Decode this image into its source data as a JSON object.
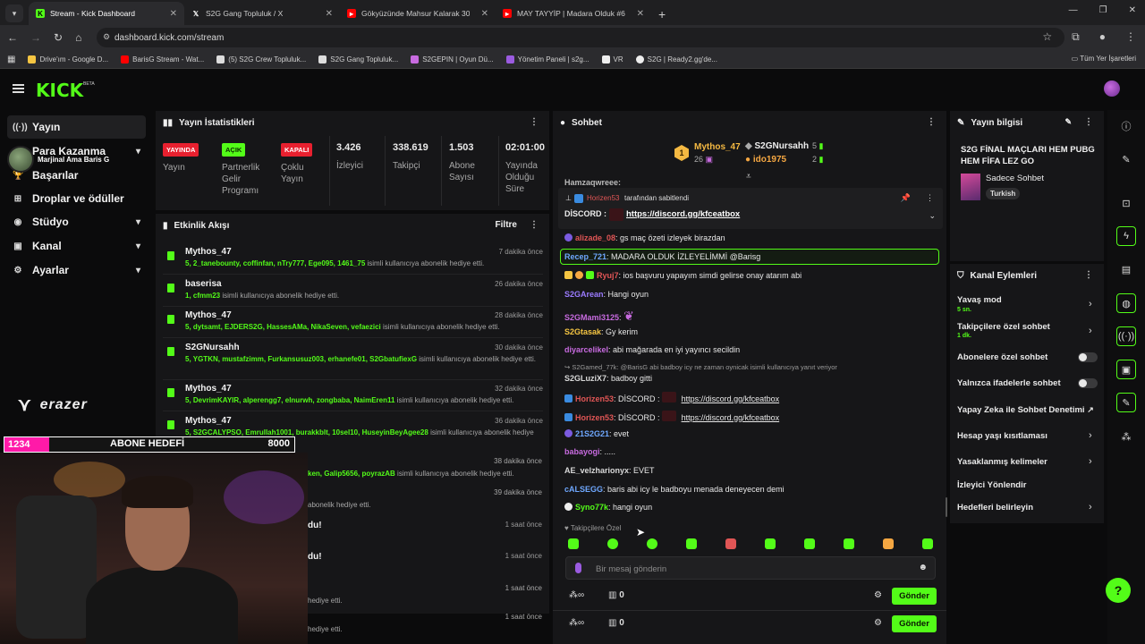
{
  "browser": {
    "tabs": [
      {
        "title": "Stream - Kick Dashboard",
        "active": true,
        "icon": "kick-icon"
      },
      {
        "title": "S2G Gang Topluluk / X",
        "active": false,
        "icon": "x-icon"
      },
      {
        "title": "Gökyüzünde Mahsur Kalarak 30",
        "active": false,
        "icon": "youtube-icon"
      },
      {
        "title": "MAY TAYYİP | Madara Olduk #6",
        "active": false,
        "icon": "youtube-icon"
      }
    ],
    "url": "dashboard.kick.com/stream",
    "bookmarks": [
      {
        "label": "Drive'ım - Google D..."
      },
      {
        "label": "BarisG Stream - Wat..."
      },
      {
        "label": "(5) S2G Crew Topluluk..."
      },
      {
        "label": "S2G Gang Topluluk..."
      },
      {
        "label": "S2GEPIN | Oyun Dü..."
      },
      {
        "label": "Yönetim Paneli | s2g..."
      },
      {
        "label": "VR"
      },
      {
        "label": "S2G | Ready2.gg'de..."
      }
    ],
    "bookmarks_right": "Tüm Yer İşaretleri"
  },
  "kick": {
    "logo": "KICK",
    "beta": "BETA"
  },
  "sidebar": {
    "items": [
      {
        "label": "Yayın",
        "icon": "broadcast-icon",
        "chev": ""
      },
      {
        "label": "Para Kazanma",
        "icon": "dollar-icon",
        "chev": "▾"
      },
      {
        "label": "Başarılar",
        "icon": "trophy-icon",
        "chev": ""
      },
      {
        "label": "Droplar ve ödüller",
        "icon": "gift-icon",
        "chev": ""
      },
      {
        "label": "Stüdyo",
        "icon": "studio-icon",
        "chev": "▾"
      },
      {
        "label": "Kanal",
        "icon": "channel-icon",
        "chev": "▾"
      },
      {
        "label": "Ayarlar",
        "icon": "gear-icon",
        "chev": "▾"
      }
    ],
    "streamer_overlay": "Marjinal Ama Baris G"
  },
  "stats": {
    "title": "Yayın İstatistikleri",
    "items": [
      {
        "badge": "YAYINDA",
        "badge_color": "red",
        "label": "Yayın"
      },
      {
        "badge": "AÇIK",
        "badge_color": "green",
        "label": "Partnerlik Gelir Programı"
      },
      {
        "badge": "KAPALI",
        "badge_color": "red",
        "label": "Çoklu Yayın"
      },
      {
        "value": "3.426",
        "label": "İzleyici"
      },
      {
        "value": "338.619",
        "label": "Takipçi"
      },
      {
        "value": "1.503",
        "label": "Abone Sayısı"
      },
      {
        "value": "02:01:00",
        "label": "Yayında Olduğu Süre"
      }
    ]
  },
  "activity": {
    "title": "Etkinlik Akışı",
    "filter": "Filtre",
    "items": [
      {
        "name": "Mythos_47",
        "time": "7 dakika önce",
        "gifts": "5, 2_tanebounty, coffinfan, nTry777, Ege095, 1461_75",
        "suffix": " isimli kullanıcıya abonelik hediye etti."
      },
      {
        "name": "baserisa",
        "time": "26 dakika önce",
        "gifts": "1, cfmm23",
        "suffix": " isimli kullanıcıya abonelik hediye etti."
      },
      {
        "name": "Mythos_47",
        "time": "28 dakika önce",
        "gifts": "5, dytsamt, EJDERS2G, HassesAMa, NikaSeven, vefaezici",
        "suffix": " isimli kullanıcıya abonelik hediye etti."
      },
      {
        "name": "S2GNursahh",
        "time": "30 dakika önce",
        "gifts": "5, YGTKN, mustafzimm, Furkansusuz003, erhanefe01, S2GbatufiexG",
        "suffix": " isimli kullanıcıya abonelik hediye etti."
      },
      {
        "name": "Mythos_47",
        "time": "32 dakika önce",
        "gifts": "5, DevrimKAYIR, alperengg7, elnurwh, zongbaba, NaimEren11",
        "suffix": " isimli kullanıcıya abonelik hediye etti."
      },
      {
        "name": "Mythos_47",
        "time": "36 dakika önce",
        "gifts": "5, S2GCALYPSO, Emrullah1001, burakkblt, 10sel10, HuseyinBeyAgee28",
        "suffix": " isimli kullanıcıya abonelik hediye etti."
      }
    ],
    "partial": [
      {
        "text": "ken, Galip5656, poyrazAB",
        "suffix": " isimli kullanıcıya abonelik hediye etti.",
        "time": "38 dakika önce"
      },
      {
        "text": "",
        "suffix": "abonelik hediye etti.",
        "time": "39 dakika önce"
      },
      {
        "text": "du!",
        "suffix": "",
        "time": "1 saat önce"
      },
      {
        "text": "du!",
        "suffix": "",
        "time": "1 saat önce"
      },
      {
        "text": "",
        "suffix": "hediye etti.",
        "time": "1 saat önce"
      },
      {
        "text": "",
        "suffix": "hediye etti.",
        "time": "1 saat önce"
      }
    ]
  },
  "overlay": {
    "goal_current": "1234",
    "goal_label": "ABONE HEDEFİ",
    "goal_target": "8000",
    "goal_progress": 0.154,
    "brand": "erazer"
  },
  "chat": {
    "title": "Sohbet",
    "leaderboard": [
      {
        "rank": "1",
        "name": "Mythos_47",
        "count": "26"
      },
      {
        "name": "S2GNursahh",
        "count": "5"
      },
      {
        "name": "ido1975",
        "count": "2"
      }
    ],
    "partial_top": "Hamzaqwreee:",
    "pinned_by": "tarafından sabitlendi",
    "pinned_user": "Horizen53",
    "pinned_label": "DİSCORD :",
    "pinned_link": "https://discord.gg/kfceatbox",
    "messages": [
      {
        "user": "alizade_08",
        "color": "#e05555",
        "text": ": gs maç özeti izleyek birazdan"
      },
      {
        "user": "Recep_721",
        "color": "#6fa8ff",
        "text": ": MADARA OLDUK İZLEYELİMMİ @Barisg"
      },
      {
        "user": "Ryuj7",
        "color": "#e05555",
        "text": ": ios başvuru yapayım simdi gelirse onay atarım abi"
      },
      {
        "user": "S2GArean",
        "color": "#9b7bff",
        "text": ": Hangi oyun"
      },
      {
        "user": "S2GMami3125",
        "color": "#c86be0",
        "text": ":"
      },
      {
        "user": "S2Gtasak",
        "color": "#f5c542",
        "text": ": Gy kerim"
      },
      {
        "user": "diyarcelikel",
        "color": "#c86be0",
        "text": ": abi mağarada en iyi yayıncı secildin"
      },
      {
        "user": "S2GLuziX7",
        "color": "#d9d9d9",
        "text": ": badboy gitti"
      },
      {
        "user": "Horizen53",
        "color": "#e05555",
        "text": ": DİSCORD :",
        "link": "https://discord.gg/kfceatbox"
      },
      {
        "user": "Horizen53",
        "color": "#e05555",
        "text": ": DİSCORD :",
        "link": "https://discord.gg/kfceatbox"
      },
      {
        "user": "21S2G21",
        "color": "#6fa8ff",
        "text": ": evet"
      },
      {
        "user": "babayogi",
        "color": "#c86be0",
        "text": ": ....."
      },
      {
        "user": "AE_velzharionyx",
        "color": "#d9d9d9",
        "text": ": EVET"
      },
      {
        "user": "cALSEGG",
        "color": "#6fa8ff",
        "text": ": baris abi icy le badboyu menada deneyecen demi"
      },
      {
        "user": "Syno77k",
        "color": "#53fc18",
        "text": ": hangi oyun"
      }
    ],
    "reply_line": "S2Gamed_77k: @BarisG abi badboy icy ne zaman oynicak isimli kullanıcıya yanıt veriyor",
    "followers_only": "Takipçilere Özel",
    "input_placeholder": "Bir mesaj gönderin",
    "points": "0",
    "send": "Gönder"
  },
  "stream_info": {
    "title": "Yayın bilgisi",
    "stream_title": "S2G FİNAL MAÇLARI HEM PUBG HEM FİFA LEZ GO",
    "category": "Sadece Sohbet",
    "tag": "Turkish"
  },
  "channel_actions": {
    "title": "Kanal Eylemleri",
    "slow_mode": "Yavaş mod",
    "slow_mode_value": "5 sn.",
    "followers_chat": "Takipçilere özel sohbet",
    "followers_chat_value": "1 dk.",
    "subs_chat": "Abonelere özel sohbet",
    "emote_chat": "Yalnızca ifadelerle sohbet",
    "ai_moderation": "Yapay Zeka ile Sohbet Denetimi",
    "account_age": "Hesap yaşı kısıtlaması",
    "banned_words": "Yasaklanmış kelimeler",
    "redirect": "İzleyici Yönlendir",
    "goals": "Hedefleri belirleyin"
  }
}
